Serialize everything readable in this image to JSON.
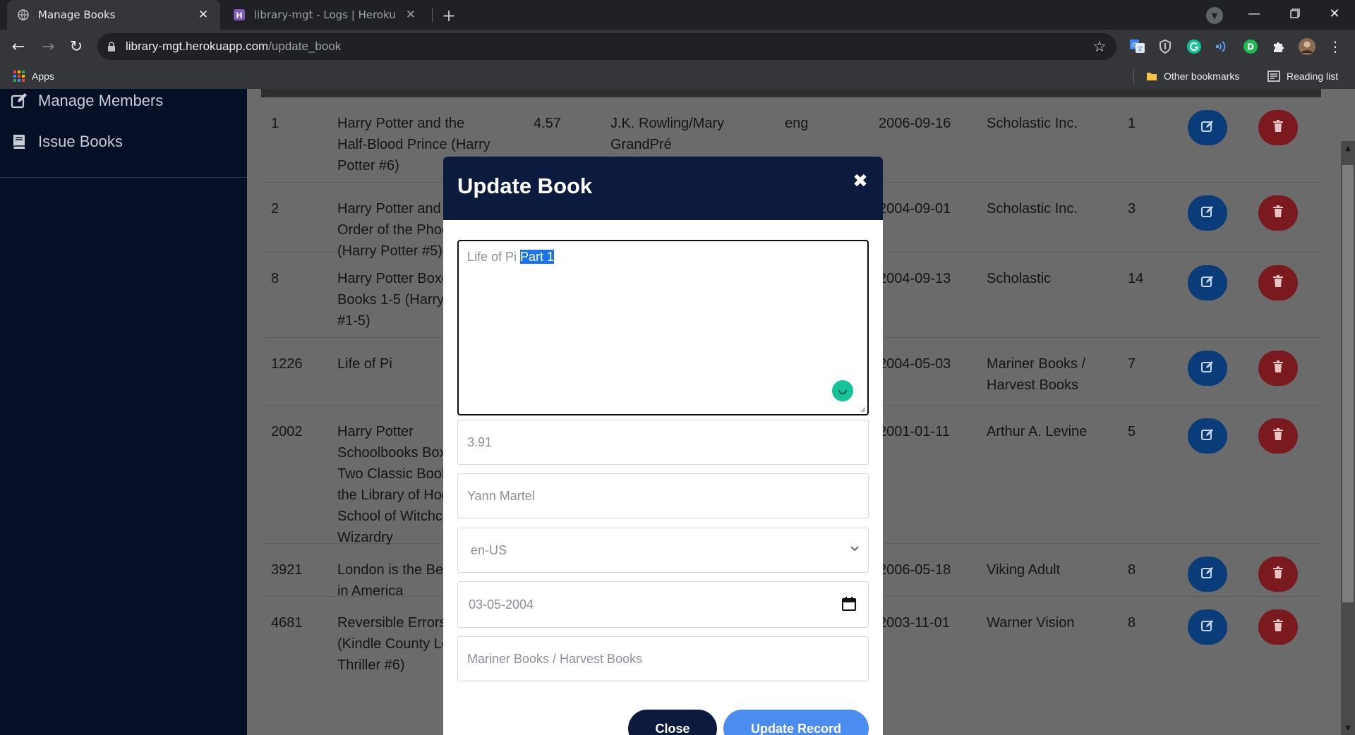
{
  "browser": {
    "tabs": [
      {
        "title": "Manage Books",
        "active": true
      },
      {
        "title": "library-mgt - Logs | Heroku",
        "active": false
      }
    ],
    "url_host": "library-mgt.herokuapp.com",
    "url_path": "/update_book",
    "bookmarks": {
      "apps": "Apps",
      "other": "Other bookmarks",
      "reading": "Reading list"
    }
  },
  "sidebar": {
    "items": [
      {
        "label": "Manage Members",
        "icon": "edit-icon"
      },
      {
        "label": "Issue Books",
        "icon": "book-icon"
      }
    ]
  },
  "table": {
    "rows": [
      {
        "id": "1",
        "title": "Harry Potter and the Half-Blood Prince (Harry Potter #6)",
        "rating": "4.57",
        "author": "J.K. Rowling/Mary GrandPré",
        "lang": "eng",
        "date": "2006-09-16",
        "publisher": "Scholastic Inc.",
        "qty": "1"
      },
      {
        "id": "2",
        "title": "Harry Potter and the Order of the Phoenix (Harry Potter #5)",
        "rating": "",
        "author": "",
        "lang": "",
        "date": "2004-09-01",
        "publisher": "Scholastic Inc.",
        "qty": "3"
      },
      {
        "id": "8",
        "title": "Harry Potter Boxed Set, Books 1-5 (Harry Potter, #1-5)",
        "rating": "",
        "author": "",
        "lang": "",
        "date": "2004-09-13",
        "publisher": "Scholastic",
        "qty": "14"
      },
      {
        "id": "1226",
        "title": "Life of Pi",
        "rating": "",
        "author": "",
        "lang": "",
        "date": "2004-05-03",
        "publisher": "Mariner Books / Harvest Books",
        "qty": "7"
      },
      {
        "id": "2002",
        "title": "Harry Potter Schoolbooks Box Set: Two Classic Books from the Library of Hogwarts School of Witchcraft and Wizardry",
        "rating": "",
        "author": "",
        "lang": "",
        "date": "2001-01-11",
        "publisher": "Arthur A. Levine",
        "qty": "5"
      },
      {
        "id": "3921",
        "title": "London is the Best City in America",
        "rating": "",
        "author": "",
        "lang": "",
        "date": "2006-05-18",
        "publisher": "Viking Adult",
        "qty": "8"
      },
      {
        "id": "4681",
        "title": "Reversible Errors (Kindle County Legal Thriller #6)",
        "rating": "",
        "author": "",
        "lang": "",
        "date": "2003-11-01",
        "publisher": "Warner Vision",
        "qty": "8"
      }
    ]
  },
  "modal": {
    "title": "Update Book",
    "close_symbol": "✖",
    "title_value_plain": "Life of Pi ",
    "title_value_selected": "Part 1",
    "rating_value": "3.91",
    "author_value": "Yann Martel",
    "lang_value": "en-US",
    "date_value": "03-05-2004",
    "publisher_value": "Mariner Books / Harvest Books",
    "close_label": "Close",
    "update_label": "Update Record"
  },
  "colors": {
    "sidebar_bg": "#050f26",
    "modal_header": "#0b1a3d",
    "edit_button": "#0b3c7a",
    "delete_button": "#7a1a1f",
    "update_button": "#4a8cf0",
    "grammarly": "#15c39a"
  }
}
